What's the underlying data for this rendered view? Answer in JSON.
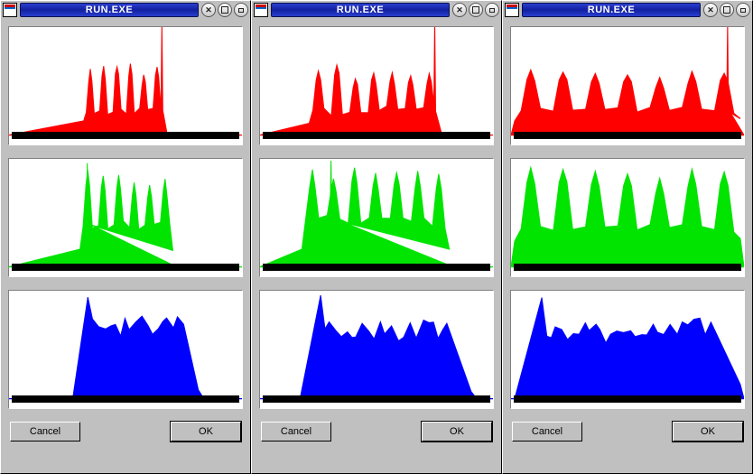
{
  "windows": [
    {
      "title": "RUN.EXE",
      "cancel": "Cancel",
      "ok": "OK"
    },
    {
      "title": "RUN.EXE",
      "cancel": "Cancel",
      "ok": "OK"
    },
    {
      "title": "RUN.EXE",
      "cancel": "Cancel",
      "ok": "OK"
    }
  ],
  "colors": {
    "red": "#ff0000",
    "green": "#00e400",
    "blue": "#0000ff"
  },
  "chart_data": [
    {
      "window": 0,
      "channels": [
        {
          "name": "red",
          "type": "area",
          "xlim": [
            0,
            255
          ],
          "ylim": [
            0,
            100
          ],
          "x_region": [
            82,
            170
          ],
          "peaks": 6,
          "peak_height": 55,
          "valley_height": 22,
          "baseline": 12,
          "spike_x": 168,
          "spike_height": 98
        },
        {
          "name": "green",
          "type": "area",
          "xlim": [
            0,
            255
          ],
          "ylim": [
            0,
            100
          ],
          "x_region": [
            78,
            180
          ],
          "peaks": 6,
          "peak_height": 78,
          "valley_height": 36,
          "baseline": 15,
          "spike_x": 86,
          "spike_height": 90
        },
        {
          "name": "blue",
          "type": "area",
          "xlim": [
            0,
            255
          ],
          "ylim": [
            0,
            100
          ],
          "x_region": [
            70,
            208
          ],
          "peak_height": 85,
          "plateau": 62,
          "taper_end": 208,
          "baseline": 8
        }
      ]
    },
    {
      "window": 1,
      "channels": [
        {
          "name": "red",
          "type": "area",
          "xlim": [
            0,
            255
          ],
          "ylim": [
            0,
            100
          ],
          "x_region": [
            54,
            196
          ],
          "peaks": 7,
          "peak_height": 55,
          "valley_height": 22,
          "baseline": 10,
          "spike_x": 192,
          "spike_height": 98
        },
        {
          "name": "green",
          "type": "area",
          "xlim": [
            0,
            255
          ],
          "ylim": [
            0,
            100
          ],
          "x_region": [
            46,
            208
          ],
          "peaks": 7,
          "peak_height": 80,
          "valley_height": 40,
          "baseline": 15,
          "spike_x": 78,
          "spike_height": 92
        },
        {
          "name": "blue",
          "type": "area",
          "xlim": [
            0,
            255
          ],
          "ylim": [
            0,
            100
          ],
          "x_region": [
            44,
            232
          ],
          "peak_height": 88,
          "plateau": 58,
          "taper_end": 232,
          "baseline": 8
        }
      ]
    },
    {
      "window": 2,
      "channels": [
        {
          "name": "red",
          "type": "area",
          "xlim": [
            0,
            255
          ],
          "ylim": [
            0,
            100
          ],
          "x_region": [
            4,
            252
          ],
          "peaks": 7,
          "peak_height": 52,
          "valley_height": 22,
          "baseline": 12,
          "spike_x": 238,
          "spike_height": 98
        },
        {
          "name": "green",
          "type": "area",
          "xlim": [
            0,
            255
          ],
          "ylim": [
            0,
            100
          ],
          "x_region": [
            4,
            252
          ],
          "peaks": 7,
          "peak_height": 80,
          "valley_height": 34,
          "baseline": 22
        },
        {
          "name": "blue",
          "type": "area",
          "xlim": [
            0,
            255
          ],
          "ylim": [
            0,
            100
          ],
          "x_region": [
            4,
            252
          ],
          "peak_height": 88,
          "plateau": 58,
          "taper_end": 252,
          "baseline": 12
        }
      ]
    }
  ]
}
